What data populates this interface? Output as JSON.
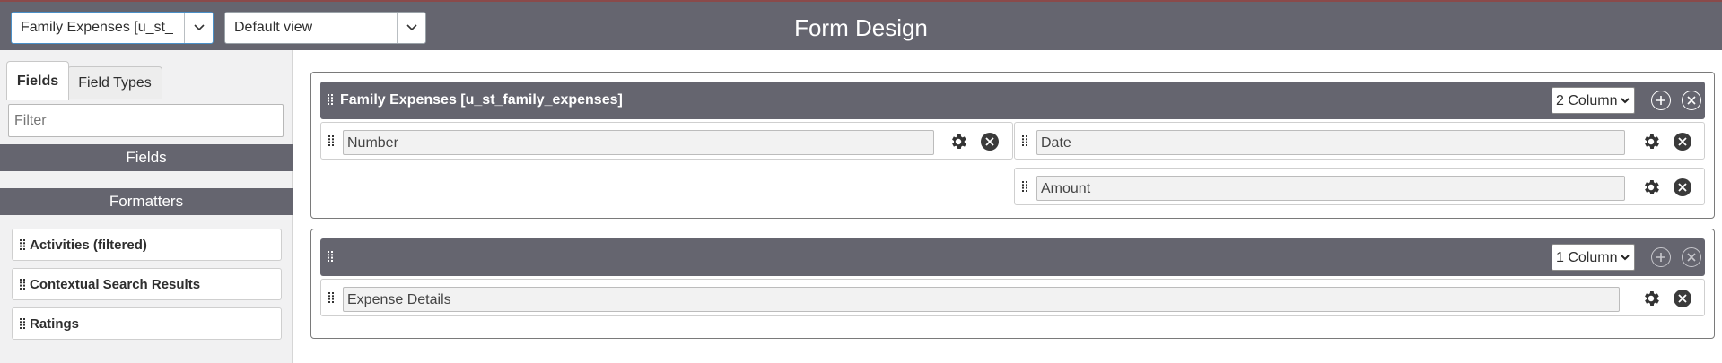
{
  "header": {
    "table_select_value": "Family Expenses [u_st_family_expenses]",
    "view_select_value": "Default view",
    "title": "Form Design"
  },
  "left": {
    "tabs": [
      {
        "label": "Fields",
        "active": true
      },
      {
        "label": "Field Types",
        "active": false
      }
    ],
    "filter_placeholder": "Filter",
    "fields_heading": "Fields",
    "formatters_heading": "Formatters",
    "formatters": [
      {
        "label": "Activities (filtered)"
      },
      {
        "label": "Contextual Search Results"
      },
      {
        "label": "Ratings"
      }
    ]
  },
  "sections": [
    {
      "title": "Family Expenses [u_st_family_expenses]",
      "columns_value": "2 Column",
      "fields": [
        {
          "label": "Number",
          "column": 1
        },
        {
          "label": "Date",
          "column": 2
        },
        {
          "label": "Amount",
          "column": 2
        }
      ]
    },
    {
      "title": "",
      "columns_value": "1 Column",
      "fields": [
        {
          "label": "Expense Details",
          "column": 1
        }
      ]
    }
  ],
  "colors": {
    "header_bg": "#65656f",
    "panel_bg": "#f1f1f2",
    "accent_border": "#4a90c8"
  },
  "icons": {
    "grip": "grip-dots-icon",
    "settings": "gear-icon",
    "remove": "close-circle-icon",
    "add": "plus-circle-icon",
    "dropdown": "chevron-down-icon"
  }
}
